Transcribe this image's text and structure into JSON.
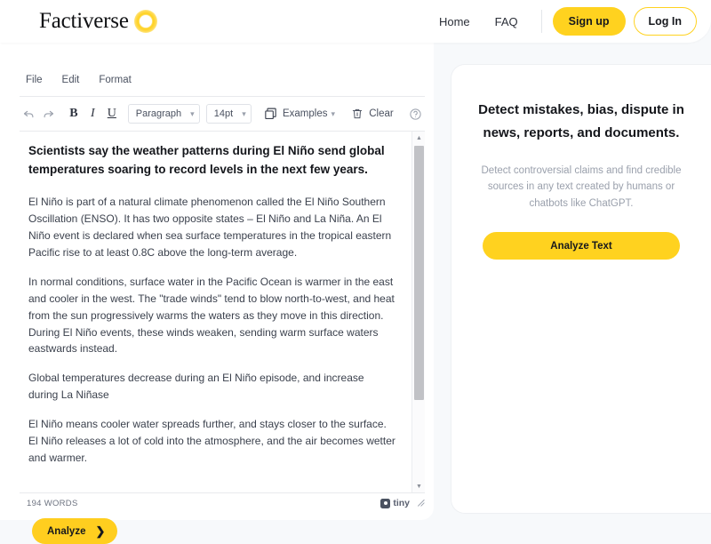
{
  "header": {
    "brand_word": "Factiverse",
    "brand_icon": "sun-icon",
    "nav": [
      {
        "label": "Home",
        "name": "home"
      },
      {
        "label": "FAQ",
        "name": "faq"
      }
    ],
    "signup_label": "Sign up",
    "login_label": "Log In"
  },
  "editor": {
    "menubar": [
      {
        "label": "File"
      },
      {
        "label": "Edit"
      },
      {
        "label": "Format"
      }
    ],
    "toolbar": {
      "undo_icon": "undo-arrow-icon",
      "redo_icon": "redo-arrow-icon",
      "bold_label": "B",
      "italic_label": "I",
      "underline_label": "U",
      "block_format": "Paragraph",
      "font_size": "14pt",
      "examples_label": "Examples",
      "examples_icon": "copy-stack-icon",
      "clear_label": "Clear",
      "clear_icon": "trash-icon",
      "help_icon": "question-circle-icon",
      "caret": "⌄"
    },
    "document": {
      "heading": "Scientists say the weather patterns during El Niño send global temperatures soaring to record levels in the next few years.",
      "paragraphs": [
        "El Niño is part of a natural climate phenomenon called the El Niño Southern Oscillation (ENSO). It has two opposite states – El Niño and La Niña. An El Niño event is declared when sea surface temperatures in the tropical eastern Pacific rise to at least 0.8C above the long-term average.",
        "In normal conditions, surface water in the Pacific Ocean is warmer in the east and cooler in the west. The \"trade winds\" tend to blow north-to-west, and heat from the sun progressively warms the waters as they move in this direction. During El Niño events, these winds weaken, sending warm surface waters eastwards instead.",
        "Global temperatures decrease during an El Niño episode, and increase during La Niñase",
        "El Niño means cooler water spreads further, and stays closer to the surface. El Niño releases a lot of cold into the atmosphere, and the air becomes wetter and warmer."
      ]
    },
    "statusbar": {
      "word_count": "194 WORDS",
      "brand": "tiny",
      "brand_icon": "tinymce-logo-icon",
      "resize_icon": "resize-grip-icon"
    },
    "analyze_button": {
      "label": "Analyze",
      "chevron": "❯"
    }
  },
  "right_panel": {
    "title": "Detect mistakes, bias, dispute in news, reports, and documents.",
    "subtitle": "Detect controversial claims and find credible sources in any text created by humans or chatbots like ChatGPT.",
    "cta_label": "Analyze Text"
  },
  "colors": {
    "brand_yellow": "#ffd21f",
    "analyze_yellow": "#ffce1f",
    "page_background": "#f7f9fb",
    "panel_white": "#ffffff",
    "text_dark": "#14161b",
    "text_muted": "#9aa0ac"
  }
}
